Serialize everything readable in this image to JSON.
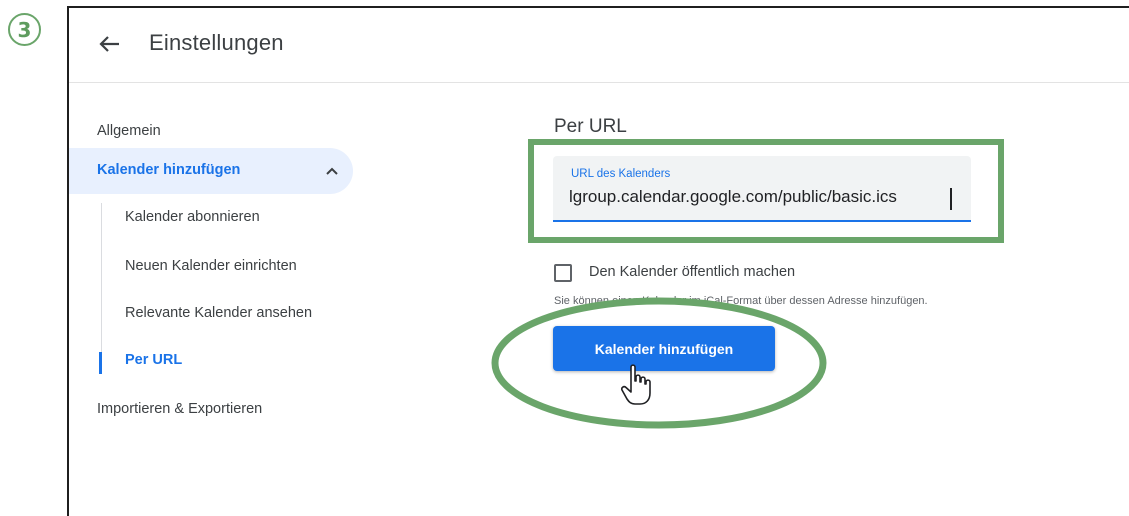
{
  "step": {
    "number": "3"
  },
  "header": {
    "title": "Einstellungen"
  },
  "nav": {
    "general": "Allgemein",
    "add_calendar": "Kalender hinzufügen",
    "sub_items": [
      "Kalender abonnieren",
      "Neuen Kalender einrichten",
      "Relevante Kalender ansehen",
      "Per URL"
    ],
    "import_export": "Importieren & Exportieren"
  },
  "main": {
    "section_title": "Per URL",
    "url_field": {
      "label": "URL des Kalenders",
      "value": "lgroup.calendar.google.com/public/basic.ics"
    },
    "checkbox_label": "Den Kalender öffentlich machen",
    "helper_text": "Sie können einen Kalender im iCal-Format über dessen Adresse hinzufügen.",
    "add_button": "Kalender hinzufügen"
  },
  "colors": {
    "accent": "#1a73e8",
    "highlight": "#6aa56a",
    "nav_active_bg": "#e8f0fe"
  },
  "icons": [
    "back-arrow-icon",
    "chevron-up-icon",
    "hand-cursor-icon"
  ]
}
